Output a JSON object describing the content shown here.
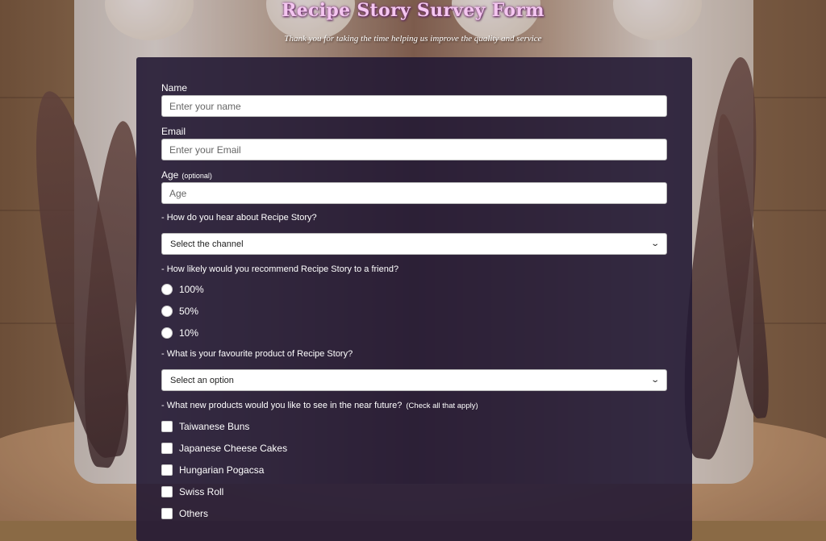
{
  "header": {
    "title": "Recipe Story Survey Form",
    "subtitle": "Thank you for taking the time helping us improve the quality and service"
  },
  "form": {
    "name": {
      "label": "Name",
      "placeholder": "Enter your name",
      "value": ""
    },
    "email": {
      "label": "Email",
      "placeholder": "Enter your Email",
      "value": ""
    },
    "age": {
      "label": "Age",
      "optional": "(optional)",
      "placeholder": "Age",
      "value": ""
    },
    "channel": {
      "question": "- How do you hear about Recipe Story?",
      "selected": "Select the channel"
    },
    "recommend": {
      "question": "- How likely would you recommend Recipe Story to a friend?",
      "options": [
        "100%",
        "50%",
        "10%"
      ]
    },
    "favourite": {
      "question": "- What is your favourite product of Recipe Story?",
      "selected": "Select an option"
    },
    "new_products": {
      "question": "- What new products would you like to see in the near future?",
      "hint": "(Check all that apply)",
      "options": [
        "Taiwanese Buns",
        "Japanese Cheese Cakes",
        "Hungarian Pogacsa",
        "Swiss Roll",
        "Others"
      ]
    }
  },
  "colors": {
    "title": "#f4c6f0",
    "panel": "#241a34",
    "text": "#ffffff"
  },
  "icons": {
    "select_arrow": "chevron-down-icon"
  }
}
